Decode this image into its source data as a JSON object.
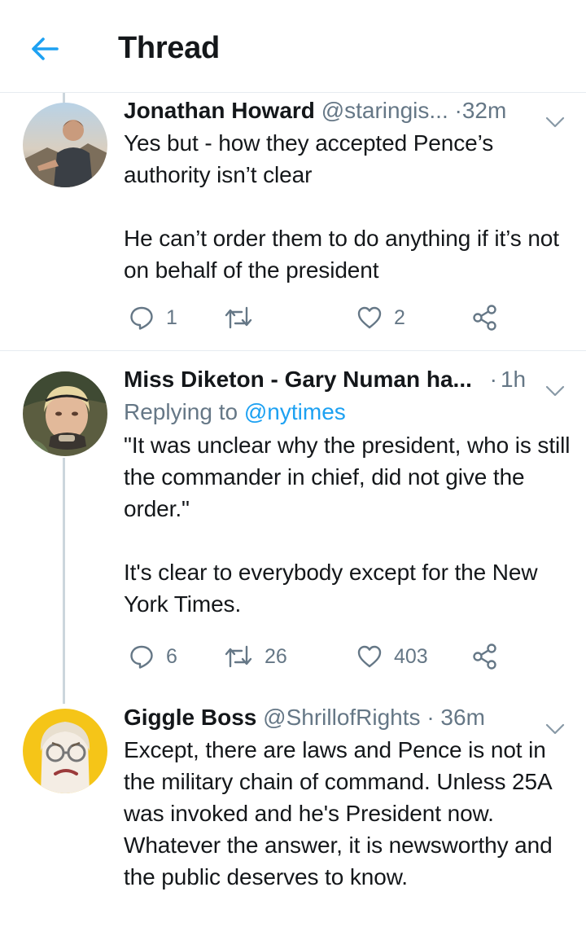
{
  "header": {
    "title": "Thread",
    "back_icon": "arrow-left-icon",
    "accent": "#1da1f2"
  },
  "tweets": [
    {
      "name": "Jonathan Howard",
      "handle": "@staringis...",
      "dot": "·",
      "time": "32m",
      "reply_prefix": "",
      "reply_handle": "",
      "text": "Yes but - how they accepted Pence’s authority isn’t clear\n\nHe can’t order them to do anything if it’s not on behalf of the president",
      "replies": "1",
      "retweets": "",
      "likes": "2"
    },
    {
      "name": "Miss Diketon - Gary Numan ha...",
      "handle": "",
      "dot": "·",
      "time": "1h",
      "reply_prefix": "Replying to",
      "reply_handle": "@nytimes",
      "text": "\"It was unclear why the president, who is still the commander in chief, did not give the order.\"\n\nIt's clear to everybody except for the New York Times.",
      "replies": "6",
      "retweets": "26",
      "likes": "403"
    },
    {
      "name": "Giggle Boss",
      "handle": "@ShrillofRights",
      "dot": "·",
      "time": "36m",
      "reply_prefix": "",
      "reply_handle": "",
      "text": "Except, there are laws and Pence is not in the military chain of command. Unless 25A was invoked and he's President now. Whatever the answer, it is newsworthy and the public deserves to know.",
      "replies": "",
      "retweets": "",
      "likes": ""
    }
  ],
  "icons": {
    "reply": "speech-bubble-icon",
    "retweet": "retweet-icon",
    "like": "heart-icon",
    "share": "share-icon",
    "caret": "chevron-down-icon"
  }
}
